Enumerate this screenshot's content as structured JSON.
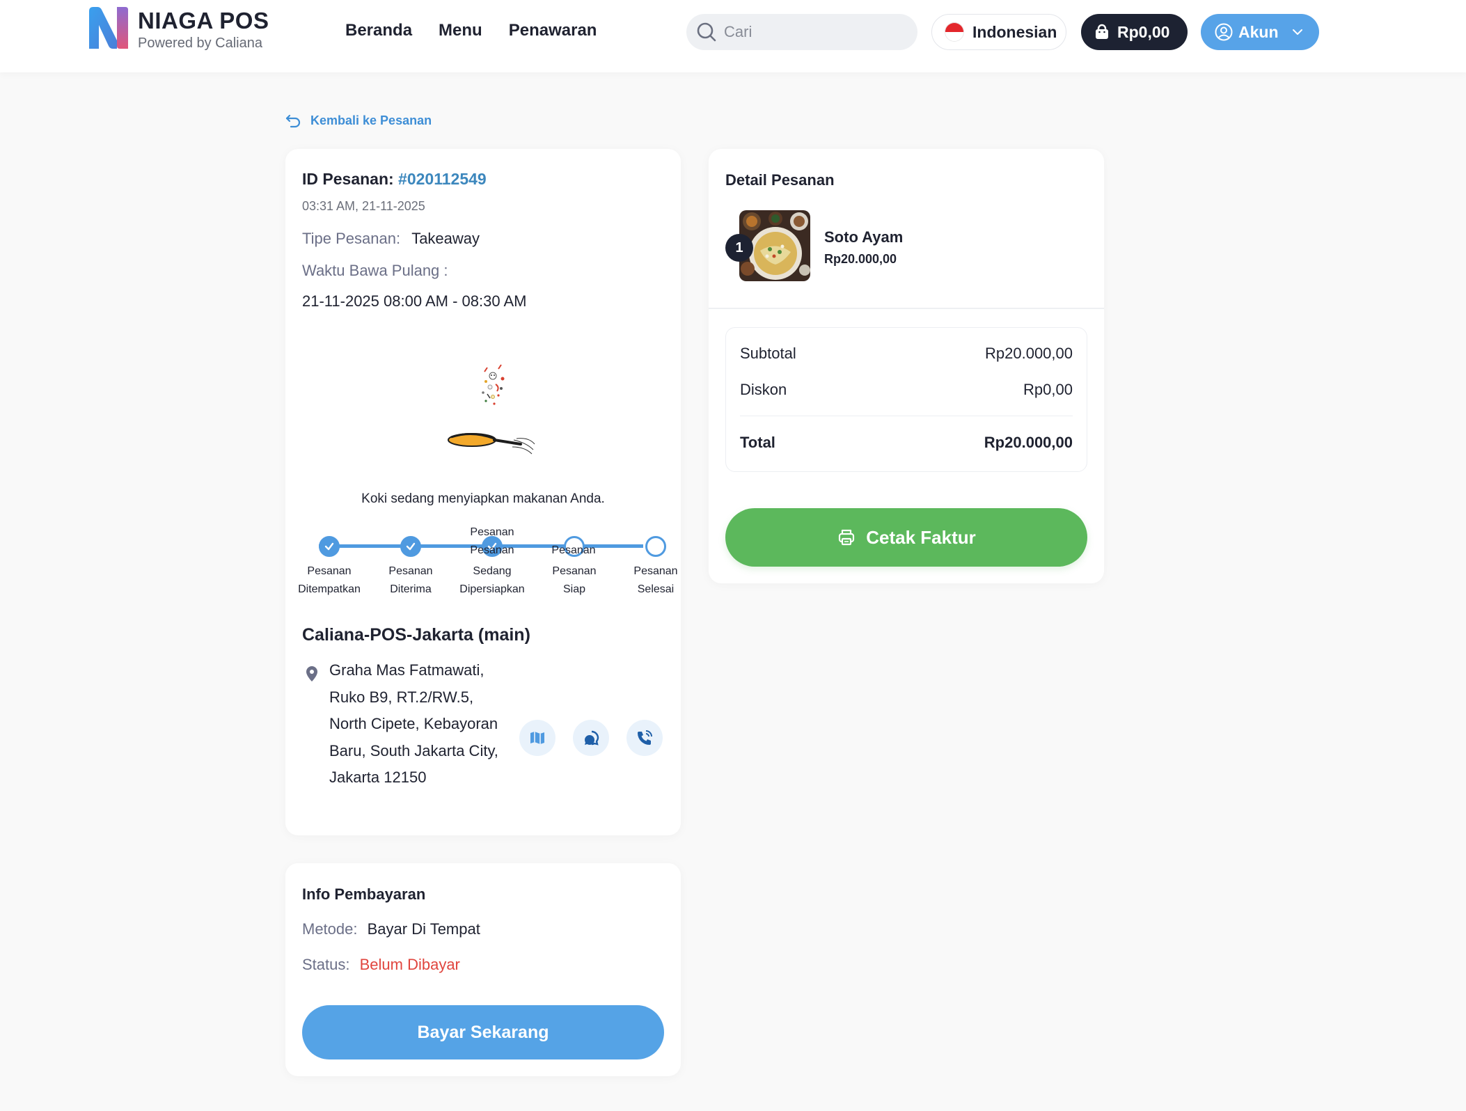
{
  "header": {
    "brand": "NIAGA POS",
    "powered_by": "Powered by Caliana",
    "nav": [
      "Beranda",
      "Menu",
      "Penawaran"
    ],
    "search_placeholder": "Cari",
    "language": "Indonesian",
    "cart_total": "Rp0,00",
    "account_label": "Akun"
  },
  "back_link": "Kembali ke Pesanan",
  "order": {
    "id_label": "ID Pesanan:",
    "id_value": "#020112549",
    "datetime": "03:31 AM, 21-11-2025",
    "type_label": "Tipe Pesanan:",
    "type_value": "Takeaway",
    "takeaway_label": "Waktu Bawa Pulang :",
    "takeaway_time": "21-11-2025 08:00 AM - 08:30 AM",
    "chef_message": "Koki sedang menyiapkan makanan Anda.",
    "steps": [
      {
        "line1": "Pesanan",
        "line2": "Ditempatkan",
        "done": true
      },
      {
        "line1": "Pesanan",
        "line2": "Diterima",
        "done": true
      },
      {
        "line1": "Pesanan",
        "line2": "Sedang",
        "line3": "Dipersiapkan",
        "done": true
      },
      {
        "line1": "Pesanan",
        "line2": "Siap",
        "done": false
      },
      {
        "line1": "Pesanan",
        "line2": "Selesai",
        "done": false
      }
    ],
    "step_overlap_labels": [
      "Pesanan",
      "Pesanan",
      "Pesanan"
    ],
    "branch_name": "Caliana-POS-Jakarta (main)",
    "address": "Graha Mas Fatmawati, Ruko B9, RT.2/RW.5, North Cipete, Kebayoran Baru, South Jakarta City, Jakarta 12150"
  },
  "payment": {
    "title": "Info Pembayaran",
    "method_label": "Metode:",
    "method_value": "Bayar Di Tempat",
    "status_label": "Status:",
    "status_value": "Belum Dibayar",
    "pay_button": "Bayar Sekarang"
  },
  "detail": {
    "title": "Detail Pesanan",
    "item": {
      "qty": "1",
      "name": "Soto Ayam",
      "price": "Rp20.000,00"
    },
    "subtotal_label": "Subtotal",
    "subtotal_value": "Rp20.000,00",
    "discount_label": "Diskon",
    "discount_value": "Rp0,00",
    "total_label": "Total",
    "total_value": "Rp20.000,00",
    "print_button": "Cetak Faktur"
  },
  "colors": {
    "accent_blue": "#57a3e8",
    "dark": "#1d2232",
    "success_green": "#5cb85c",
    "danger_red": "#e0453e",
    "order_id_blue": "#3c87bd"
  },
  "icons": [
    "logo-n-icon",
    "search-icon",
    "indonesia-flag-icon",
    "shopping-bag-icon",
    "user-circle-icon",
    "chevron-down-icon",
    "undo-arrow-icon",
    "check-icon",
    "map-pin-icon",
    "map-icon",
    "chat-icon",
    "phone-icon",
    "printer-icon",
    "chef-pan-illustration"
  ]
}
